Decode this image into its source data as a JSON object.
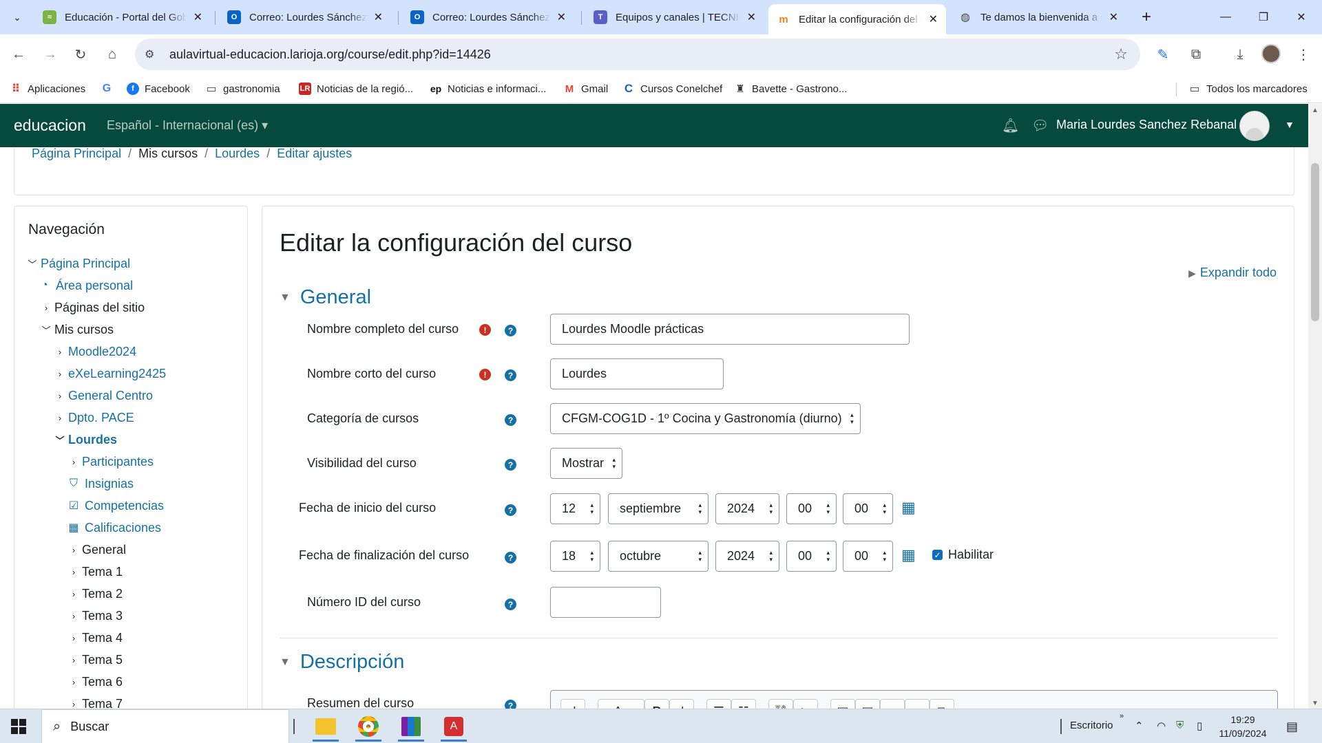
{
  "browser": {
    "tabs": [
      {
        "title": "Educación - Portal del Gobierno",
        "active": false
      },
      {
        "title": "Correo: Lourdes Sánchez Rebanal",
        "active": false
      },
      {
        "title": "Correo: Lourdes Sánchez Rebanal",
        "active": false
      },
      {
        "title": "Equipos y canales | TECNICOS",
        "active": false
      },
      {
        "title": "Editar la configuración del curso",
        "active": true
      },
      {
        "title": "Te damos la bienvenida a Chrome",
        "active": false
      }
    ],
    "url": "aulavirtual-educacion.larioja.org/course/edit.php?id=14426",
    "bookmarks": [
      {
        "label": "Aplicaciones"
      },
      {
        "label": ""
      },
      {
        "label": "Facebook"
      },
      {
        "label": "gastronomia"
      },
      {
        "label": "Noticias de la regió..."
      },
      {
        "label": "Noticias e informaci..."
      },
      {
        "label": "Gmail"
      },
      {
        "label": "Cursos Conelchef"
      },
      {
        "label": "Bavette - Gastrono..."
      }
    ],
    "all_bookmarks": "Todos los marcadores"
  },
  "moodle_nav": {
    "brand": "educacion",
    "language": "Español - Internacional (es)",
    "user_name": "Maria Lourdes Sanchez Rebanal"
  },
  "breadcrumb": {
    "items": [
      "Página Principal",
      "Mis cursos",
      "Lourdes",
      "Editar ajustes"
    ]
  },
  "navigation": {
    "title": "Navegación",
    "items": [
      "Página Principal",
      "Área personal",
      "Páginas del sitio",
      "Mis cursos",
      "Moodle2024",
      "eXeLearning2425",
      "General Centro",
      "Dpto. PACE",
      "Lourdes",
      "Participantes",
      "Insignias",
      "Competencias",
      "Calificaciones",
      "General",
      "Tema 1",
      "Tema 2",
      "Tema 3",
      "Tema 4",
      "Tema 5",
      "Tema 6",
      "Tema 7"
    ]
  },
  "form": {
    "title": "Editar la configuración del curso",
    "expand_all": "Expandir todo",
    "section_general": "General",
    "section_description": "Descripción",
    "labels": {
      "fullname": "Nombre completo del curso",
      "shortname": "Nombre corto del curso",
      "category": "Categoría de cursos",
      "visibility": "Visibilidad del curso",
      "startdate": "Fecha de inicio del curso",
      "enddate": "Fecha de finalización del curso",
      "idnumber": "Número ID del curso",
      "summary": "Resumen del curso"
    },
    "values": {
      "fullname": "Lourdes Moodle prácticas",
      "shortname": "Lourdes",
      "category": "CFGM-COG1D - 1º Cocina y Gastronomía (diurno)",
      "visibility": "Mostrar",
      "start_day": "12",
      "start_month": "septiembre",
      "start_year": "2024",
      "start_hour": "00",
      "start_minute": "00",
      "end_day": "18",
      "end_month": "octubre",
      "end_year": "2024",
      "end_hour": "00",
      "end_minute": "00",
      "idnumber": ""
    },
    "enable_label": "Habilitar"
  },
  "taskbar": {
    "search_placeholder": "Buscar",
    "desktop_label": "Escritorio",
    "time": "19:29",
    "date": "11/09/2024"
  },
  "colors": {
    "navbar": "#054a3d",
    "link": "#1570a6",
    "required": "#ca3120",
    "tabbar": "#d3e3fd"
  }
}
